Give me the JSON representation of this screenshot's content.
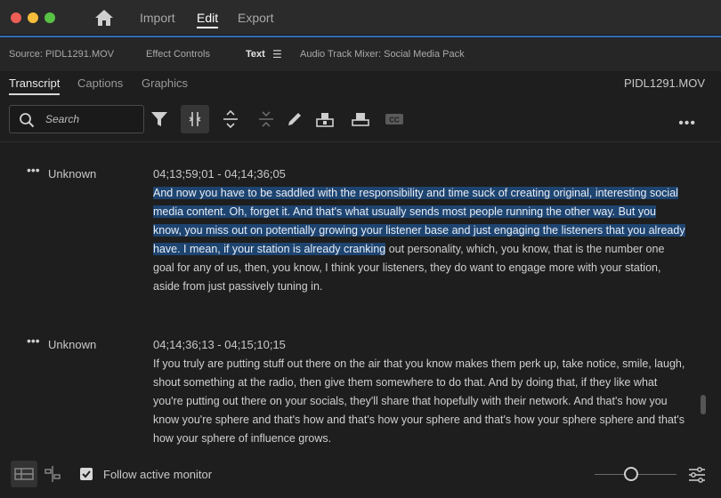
{
  "titlebar": {
    "nav": [
      "Import",
      "Edit",
      "Export"
    ],
    "active_nav": "Edit",
    "home_icon": "home-icon"
  },
  "panel_tabs": {
    "source": "Source: PIDL1291.MOV",
    "effect_controls": "Effect Controls",
    "text": "Text",
    "text_menu_icon": "☰",
    "audio_mixer": "Audio Track Mixer: Social Media Pack"
  },
  "subtabs": {
    "transcript": "Transcript",
    "captions": "Captions",
    "graphics": "Graphics",
    "clip_name": "PIDL1291.MOV"
  },
  "toolbar": {
    "search_placeholder": "Search",
    "icons": [
      "filter-icon",
      "merge-segments-icon",
      "split-segment-icon",
      "collapse-icon",
      "pencil-icon",
      "insert-icon",
      "overwrite-icon",
      "captions-icon"
    ],
    "more_icon": "•••"
  },
  "segments": [
    {
      "dots": "•••",
      "speaker": "Unknown",
      "timecode": "04;13;59;01 - 04;14;36;05",
      "text_highlighted": "And now you have to be saddled with the responsibility and time suck of creating original, interesting social media content. Oh, forget it. And that's what usually sends most people running the other way. But you know, you miss out on potentially growing your listener base and just engaging the listeners that you already have. I mean, if your station is already cranking",
      "text_rest": " out personality, which, you know, that is the number one goal for any of us, then, you know, I think your listeners, they do want to engage more with your station, aside from just passively tuning in."
    },
    {
      "dots": "•••",
      "speaker": "Unknown",
      "timecode": "04;14;36;13 - 04;15;10;15",
      "text_highlighted": "",
      "text_rest": "If you truly are putting stuff out there on the air that you know makes them perk up, take notice, smile, laugh, shout something at the radio, then give them somewhere to do that. And by doing that, if they like what you're putting out there on your socials, they'll share that hopefully with their network. And that's how you know you're sphere and that's how and that's how your sphere and that's how your sphere sphere and that's how your sphere of influence grows."
    }
  ],
  "footer": {
    "follow_label": "Follow active monitor",
    "follow_checked": true,
    "zoom_level": 0.45
  },
  "colors": {
    "accent": "#2f6db5",
    "highlight": "#1e4470",
    "background": "#1e1e1e"
  }
}
